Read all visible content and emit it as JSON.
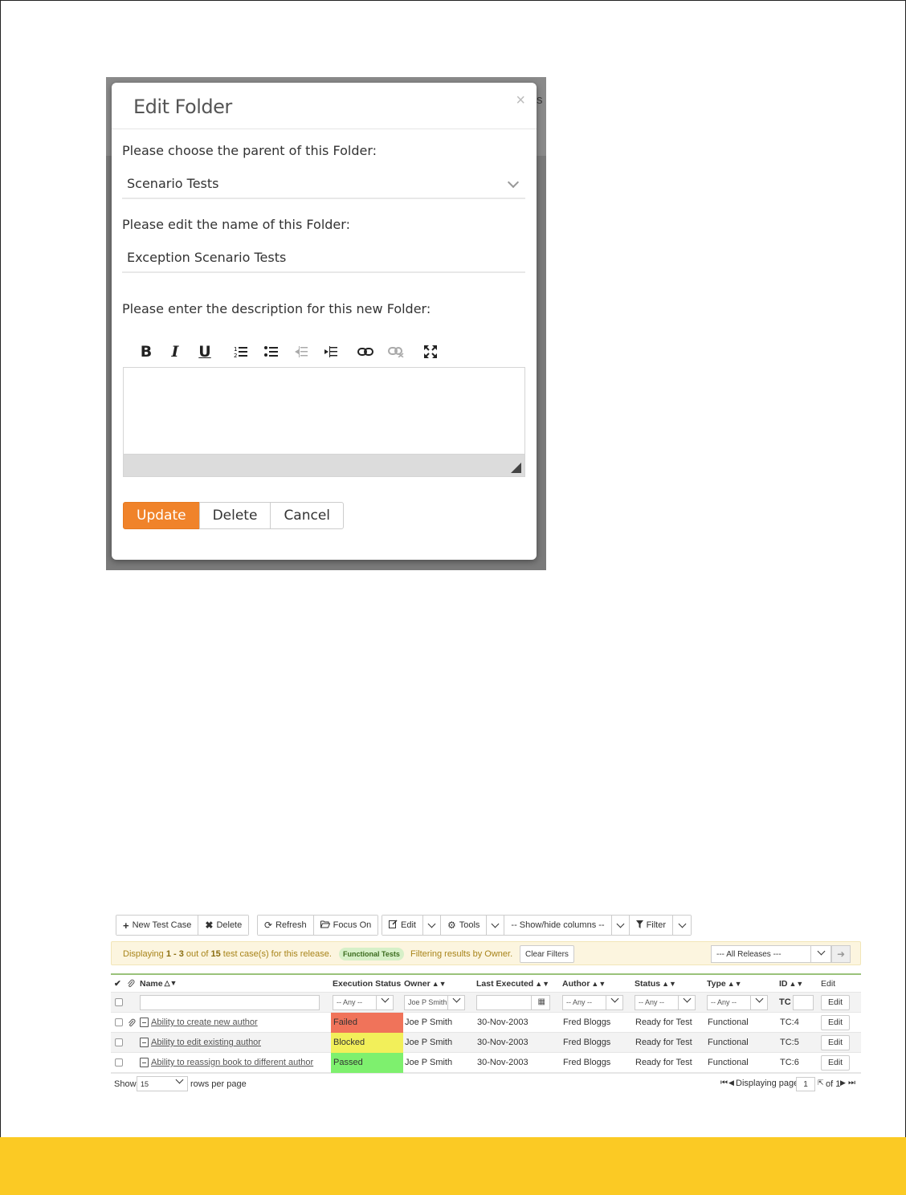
{
  "edit_folder": {
    "title": "Edit Folder",
    "close_glyph": "×",
    "background_letter": "s",
    "parent_label": "Please choose the parent of this Folder:",
    "parent_value": "Scenario Tests",
    "name_label": "Please edit the name of this Folder:",
    "name_value": "Exception Scenario Tests",
    "description_label": "Please enter the description for this new Folder:",
    "toolbar": [
      "bold-icon",
      "italic-icon",
      "underline-icon",
      "ordered-list-icon",
      "bullet-list-icon",
      "outdent-icon",
      "indent-icon",
      "link-icon",
      "unlink-icon",
      "fullscreen-icon"
    ],
    "buttons": {
      "update": "Update",
      "delete": "Delete",
      "cancel": "Cancel"
    },
    "accent_color": "#f0832a"
  },
  "test_cases": {
    "toolbar": {
      "new_test_case": "New Test Case",
      "delete": "Delete",
      "refresh": "Refresh",
      "focus_on": "Focus On",
      "edit": "Edit",
      "tools": "Tools",
      "show_hide": "-- Show/hide columns --",
      "filter": "Filter"
    },
    "info": {
      "prefix": "Displaying ",
      "range": "1 - 3",
      "mid": " out of ",
      "total": "15",
      "suffix": " test case(s) for this release.",
      "tag": "Functional Tests",
      "filter_msg": "Filtering results by Owner.",
      "clear": "Clear Filters",
      "release": "--- All Releases ---"
    },
    "columns": {
      "name": "Name",
      "execution_status": "Execution Status",
      "owner": "Owner",
      "last_executed": "Last Executed",
      "author": "Author",
      "status": "Status",
      "type": "Type",
      "id": "ID",
      "edit": "Edit"
    },
    "filters": {
      "exec_any": "-- Any --",
      "owner": "Joe P Smith",
      "author_any": "-- Any --",
      "status_any": "-- Any --",
      "type_any": "-- Any --",
      "id_prefix": "TC",
      "edit": "Edit"
    },
    "rows": [
      {
        "name": "Ability to create new author",
        "exec": "Failed",
        "exec_color": "#f0735a",
        "owner": "Joe P Smith",
        "date": "30-Nov-2003",
        "author": "Fred Bloggs",
        "status": "Ready for Test",
        "type": "Functional",
        "id": "TC:4",
        "edit": "Edit"
      },
      {
        "name": "Ability to edit existing author",
        "exec": "Blocked",
        "exec_color": "#f2ef5a",
        "owner": "Joe P Smith",
        "date": "30-Nov-2003",
        "author": "Fred Bloggs",
        "status": "Ready for Test",
        "type": "Functional",
        "id": "TC:5",
        "edit": "Edit"
      },
      {
        "name": "Ability to reassign book to different author",
        "exec": "Passed",
        "exec_color": "#7ef06e",
        "owner": "Joe P Smith",
        "date": "30-Nov-2003",
        "author": "Fred Bloggs",
        "status": "Ready for Test",
        "type": "Functional",
        "id": "TC:6",
        "edit": "Edit"
      }
    ],
    "pager": {
      "show": "Show",
      "rows_value": "15",
      "rows_per_page": "rows per page",
      "displaying_page": "Displaying page",
      "page": "1",
      "of_label": "of 1"
    }
  },
  "footer_color": "#fbca24"
}
